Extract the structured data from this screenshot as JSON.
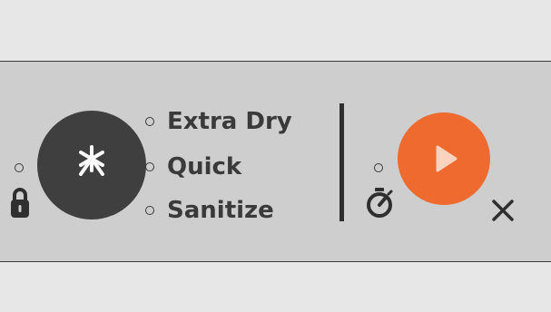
{
  "panel": {
    "options": [
      {
        "label": "Extra Dry"
      },
      {
        "label": "Quick"
      },
      {
        "label": "Sanitize"
      }
    ],
    "icons": {
      "options_button": "asterisk-icon",
      "lock": "lock-icon",
      "timer": "timer-icon",
      "start": "play-icon",
      "cancel": "close-icon"
    },
    "colors": {
      "start_button": "#ef6a2e",
      "options_button": "#3f3f3f",
      "panel_background": "#cdcecd",
      "text": "#3a3a3a"
    }
  }
}
